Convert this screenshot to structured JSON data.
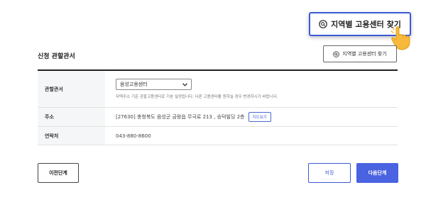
{
  "callout": {
    "label": "지역별 고용센터 찾기"
  },
  "section": {
    "title": "신청 관할관서",
    "find_button_label": "지역별 고용센터 찾기"
  },
  "form": {
    "office": {
      "label": "관할관서",
      "selected": "음성고용센터",
      "help": "자택주소 기준 관할고용센터로 기본 설정됩니다. 다른 고용센터를 원하실 경우 변경하시기 바랍니다."
    },
    "address": {
      "label": "주소",
      "value": "[27630] 충청북도 음성군 금왕읍 무극로 213 , 승덕빌딩 2층",
      "map_button": "지도보기"
    },
    "phone": {
      "label": "연락처",
      "value": "043-880-8600"
    }
  },
  "footer": {
    "prev_label": "이전단계",
    "save_label": "저장",
    "next_label": "다음단계"
  },
  "colors": {
    "accent": "#3c5ad7",
    "primary_button": "#4a63e0",
    "hand": "#f7b93b"
  },
  "icons": {
    "callout_icon": "search-icon",
    "hand_icon": "pointing-hand-icon",
    "select_icon": "chevron-down-icon"
  }
}
